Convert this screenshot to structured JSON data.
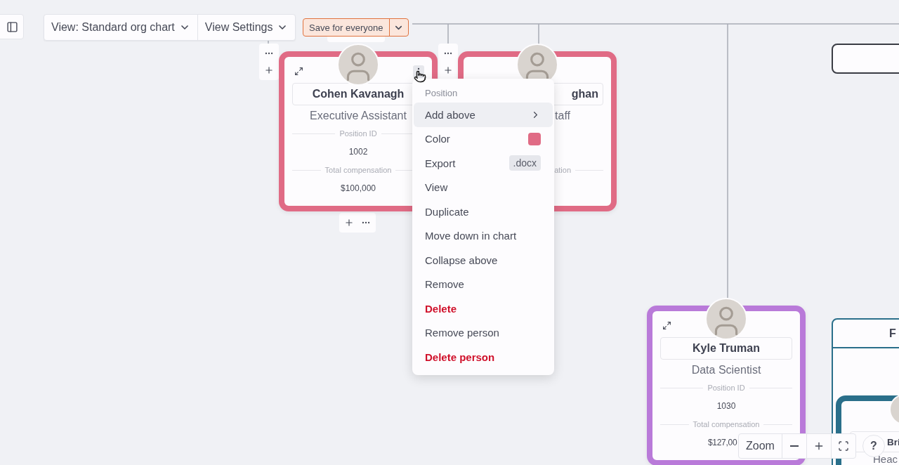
{
  "toolbar": {
    "view": "View: Standard org chart",
    "settings": "View Settings",
    "save": "Save for everyone"
  },
  "cards": [
    {
      "kind": "full",
      "name": "Cohen Kavanagh",
      "title": "Executive Assistant",
      "color": "#e06b85",
      "fields": [
        {
          "kind": "label_value",
          "label": "Position ID",
          "value": "1002"
        },
        {
          "kind": "label_value",
          "label": "Total compensation",
          "value": "$100,000"
        }
      ]
    },
    {
      "kind": "clipped",
      "name": "ghan",
      "title": "taff",
      "color": "#e06b85",
      "fields": [
        {
          "kind": "label_only",
          "label": "ation"
        }
      ]
    },
    {
      "kind": "full",
      "name": "Kyle Truman",
      "title": "Data Scientist",
      "color": "#b97ad9",
      "fields": [
        {
          "kind": "label_value",
          "label": "Position ID",
          "value": "1030"
        },
        {
          "kind": "cut",
          "label": "Total compensation",
          "value": "$127,00"
        }
      ]
    }
  ],
  "group": {
    "header": "F",
    "color": "#2a6f8a",
    "card": {
      "name": "Bri",
      "title": "Heac"
    }
  },
  "menu": {
    "header": "Position",
    "items": [
      {
        "kind": "submenu",
        "label": "Add above",
        "highlighted": true
      },
      {
        "kind": "color",
        "label": "Color",
        "color": "#e06b85",
        "highlighted": false
      },
      {
        "kind": "badge",
        "label": "Export",
        "badge": ".docx",
        "highlighted": false
      },
      {
        "kind": "plain",
        "label": "View",
        "highlighted": false
      },
      {
        "kind": "plain",
        "label": "Duplicate",
        "highlighted": false
      },
      {
        "kind": "plain",
        "label": "Move down in chart",
        "highlighted": false
      },
      {
        "kind": "plain",
        "label": "Collapse above",
        "highlighted": false
      },
      {
        "kind": "plain",
        "label": "Remove",
        "highlighted": false
      },
      {
        "kind": "danger",
        "label": "Delete",
        "highlighted": false
      },
      {
        "kind": "plain",
        "label": "Remove person",
        "highlighted": false
      },
      {
        "kind": "danger",
        "label": "Delete person",
        "highlighted": false
      }
    ]
  },
  "zoom": {
    "label": "Zoom"
  },
  "help": "?"
}
